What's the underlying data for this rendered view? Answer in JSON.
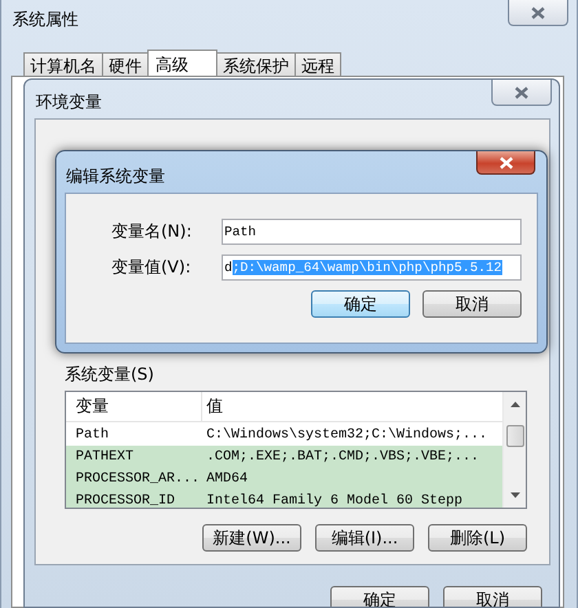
{
  "window": {
    "title": "系统属性"
  },
  "tabs": [
    {
      "label": "计算机名",
      "selected": false
    },
    {
      "label": "硬件",
      "selected": false
    },
    {
      "label": "高级",
      "selected": true
    },
    {
      "label": "系统保护",
      "selected": false
    },
    {
      "label": "远程",
      "selected": false
    }
  ],
  "env_dialog": {
    "title": "环境变量",
    "system_vars_label": "系统变量(S)",
    "table": {
      "columns": [
        "变量",
        "值"
      ],
      "rows": [
        {
          "cells": [
            "Path",
            "C:\\Windows\\system32;C:\\Windows;..."
          ],
          "selected": false
        },
        {
          "cells": [
            "PATHEXT",
            ".COM;.EXE;.BAT;.CMD;.VBS;.VBE;..."
          ],
          "selected": true
        },
        {
          "cells": [
            "PROCESSOR_AR...",
            "AMD64"
          ],
          "selected": true
        },
        {
          "cells": [
            "PROCESSOR_ID",
            "Intel64 Family 6 Model 60 Stepp"
          ],
          "selected": true
        }
      ]
    },
    "buttons": [
      "新建(W)...",
      "编辑(I)...",
      "删除(L)"
    ],
    "footer_buttons": [
      "确定",
      "取消"
    ]
  },
  "edit_dialog": {
    "title": "编辑系统变量",
    "fields": [
      {
        "label": "变量名(N):",
        "value": "Path"
      },
      {
        "label": "变量值(V):",
        "value": "d",
        "selected_value": ";D:\\wamp_64\\wamp\\bin\\php\\php5.5.12"
      }
    ],
    "buttons": [
      {
        "label": "确定",
        "default": true
      },
      {
        "label": "取消",
        "default": false
      }
    ]
  }
}
